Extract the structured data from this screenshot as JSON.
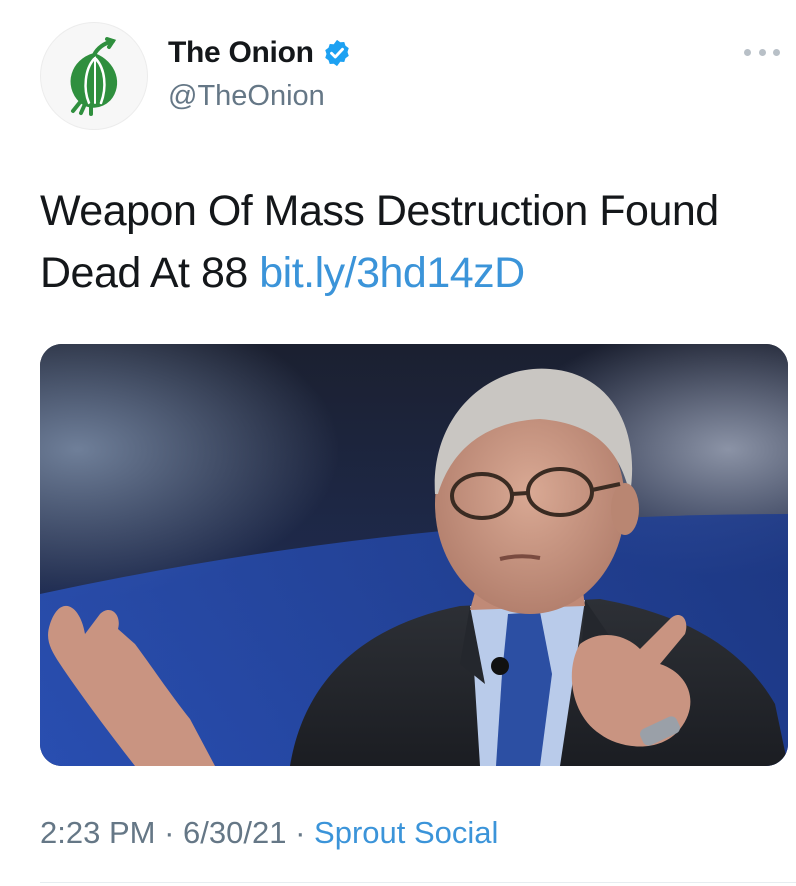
{
  "tweet": {
    "author": {
      "display_name": "The Onion",
      "handle": "@TheOnion",
      "verified": true,
      "avatar_icon": "onion-logo-icon"
    },
    "text": "Weapon Of Mass Destruction Found Dead At 88",
    "link": "bit.ly/3hd14zD",
    "image": "photo of an elderly man in glasses, suit and blue tie, gesturing with both hands",
    "time": "2:23 PM",
    "date": "6/30/21",
    "source": "Sprout Social",
    "separator": "·"
  },
  "colors": {
    "text": "#14171a",
    "secondary": "#657786",
    "link": "#3b94d9",
    "verified": "#1da1f2",
    "onion_green": "#2f8f3e"
  }
}
